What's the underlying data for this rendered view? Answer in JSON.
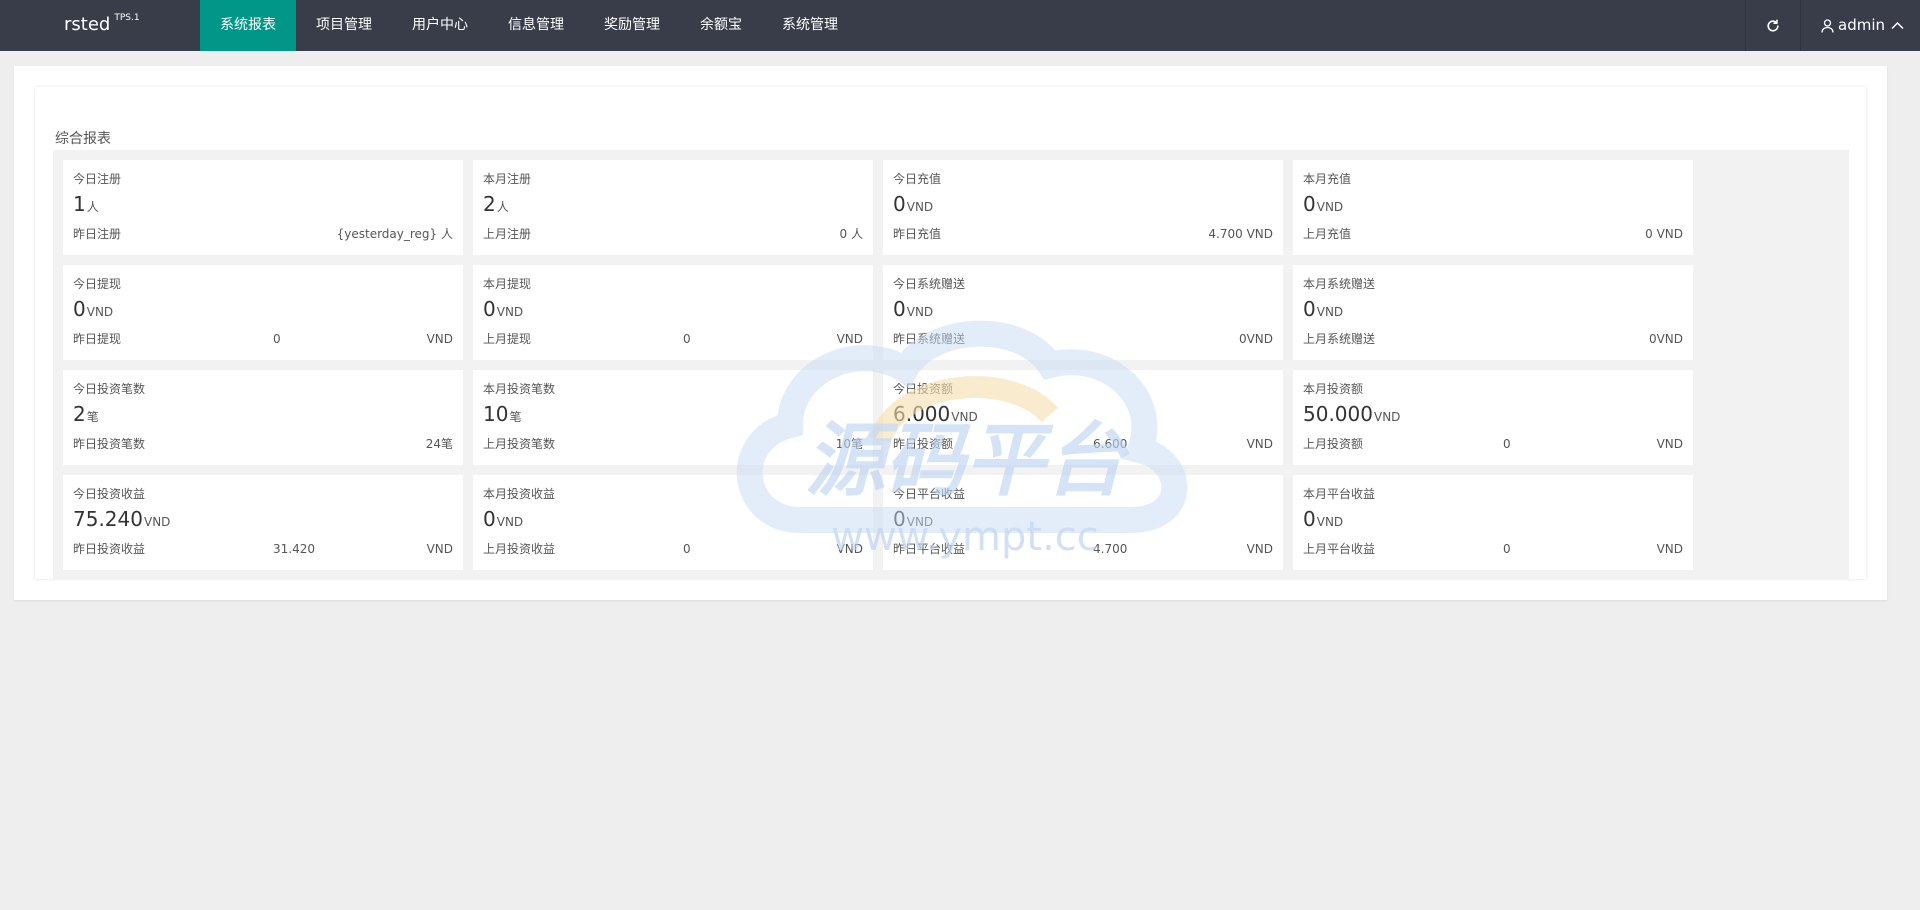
{
  "brand": {
    "name": "rsted",
    "version": "TPS.1"
  },
  "nav": [
    {
      "label": "系统报表",
      "active": true
    },
    {
      "label": "项目管理",
      "active": false
    },
    {
      "label": "用户中心",
      "active": false
    },
    {
      "label": "信息管理",
      "active": false
    },
    {
      "label": "奖励管理",
      "active": false
    },
    {
      "label": "余额宝",
      "active": false
    },
    {
      "label": "系统管理",
      "active": false
    }
  ],
  "toolbar": {
    "refresh_icon": "refresh-icon",
    "user_icon": "user-icon",
    "username": "admin",
    "chevron_icon": "chevron-up-icon"
  },
  "report": {
    "title": "综合报表"
  },
  "cards": [
    {
      "label": "今日注册",
      "value": "1",
      "unit": "人",
      "foot_label": "昨日注册",
      "foot_mid": "",
      "foot_right": "{yesterday_reg} 人"
    },
    {
      "label": "本月注册",
      "value": "2",
      "unit": "人",
      "foot_label": "上月注册",
      "foot_mid": "",
      "foot_right": "0 人"
    },
    {
      "label": "今日充值",
      "value": "0",
      "unit": "VND",
      "foot_label": "昨日充值",
      "foot_mid": "",
      "foot_right": "4.700 VND"
    },
    {
      "label": "本月充值",
      "value": "0",
      "unit": "VND",
      "foot_label": "上月充值",
      "foot_mid": "",
      "foot_right": "0 VND"
    },
    {
      "label": "今日提现",
      "value": "0",
      "unit": "VND",
      "foot_label": "昨日提现",
      "foot_mid": "0",
      "foot_right": "VND"
    },
    {
      "label": "本月提现",
      "value": "0",
      "unit": "VND",
      "foot_label": "上月提现",
      "foot_mid": "0",
      "foot_right": "VND"
    },
    {
      "label": "今日系统赠送",
      "value": "0",
      "unit": "VND",
      "foot_label": "昨日系统赠送",
      "foot_mid": "",
      "foot_right": "0VND"
    },
    {
      "label": "本月系统赠送",
      "value": "0",
      "unit": "VND",
      "foot_label": "上月系统赠送",
      "foot_mid": "",
      "foot_right": "0VND"
    },
    {
      "label": "今日投资笔数",
      "value": "2",
      "unit": "笔",
      "foot_label": "昨日投资笔数",
      "foot_mid": "",
      "foot_right": "24笔"
    },
    {
      "label": "本月投资笔数",
      "value": "10",
      "unit": "笔",
      "foot_label": "上月投资笔数",
      "foot_mid": "",
      "foot_right": "10笔"
    },
    {
      "label": "今日投资额",
      "value": "6.000",
      "unit": "VND",
      "foot_label": "昨日投资额",
      "foot_mid": "6.600",
      "foot_right": "VND"
    },
    {
      "label": "本月投资额",
      "value": "50.000",
      "unit": "VND",
      "foot_label": "上月投资额",
      "foot_mid": "0",
      "foot_right": "VND"
    },
    {
      "label": "今日投资收益",
      "value": "75.240",
      "unit": "VND",
      "foot_label": "昨日投资收益",
      "foot_mid": "31.420",
      "foot_right": "VND"
    },
    {
      "label": "本月投资收益",
      "value": "0",
      "unit": "VND",
      "foot_label": "上月投资收益",
      "foot_mid": "0",
      "foot_right": "VND"
    },
    {
      "label": "今日平台收益",
      "value": "0",
      "unit": "VND",
      "foot_label": "昨日平台收益",
      "foot_mid": "4.700",
      "foot_right": "VND"
    },
    {
      "label": "本月平台收益",
      "value": "0",
      "unit": "VND",
      "foot_label": "上月平台收益",
      "foot_mid": "0",
      "foot_right": "VND"
    }
  ],
  "watermark": {
    "title": "源码平台",
    "url": "www.ympt.cc"
  },
  "colors": {
    "topbar": "#393d49",
    "accent": "#009688",
    "page_bg": "#eeeeee"
  }
}
